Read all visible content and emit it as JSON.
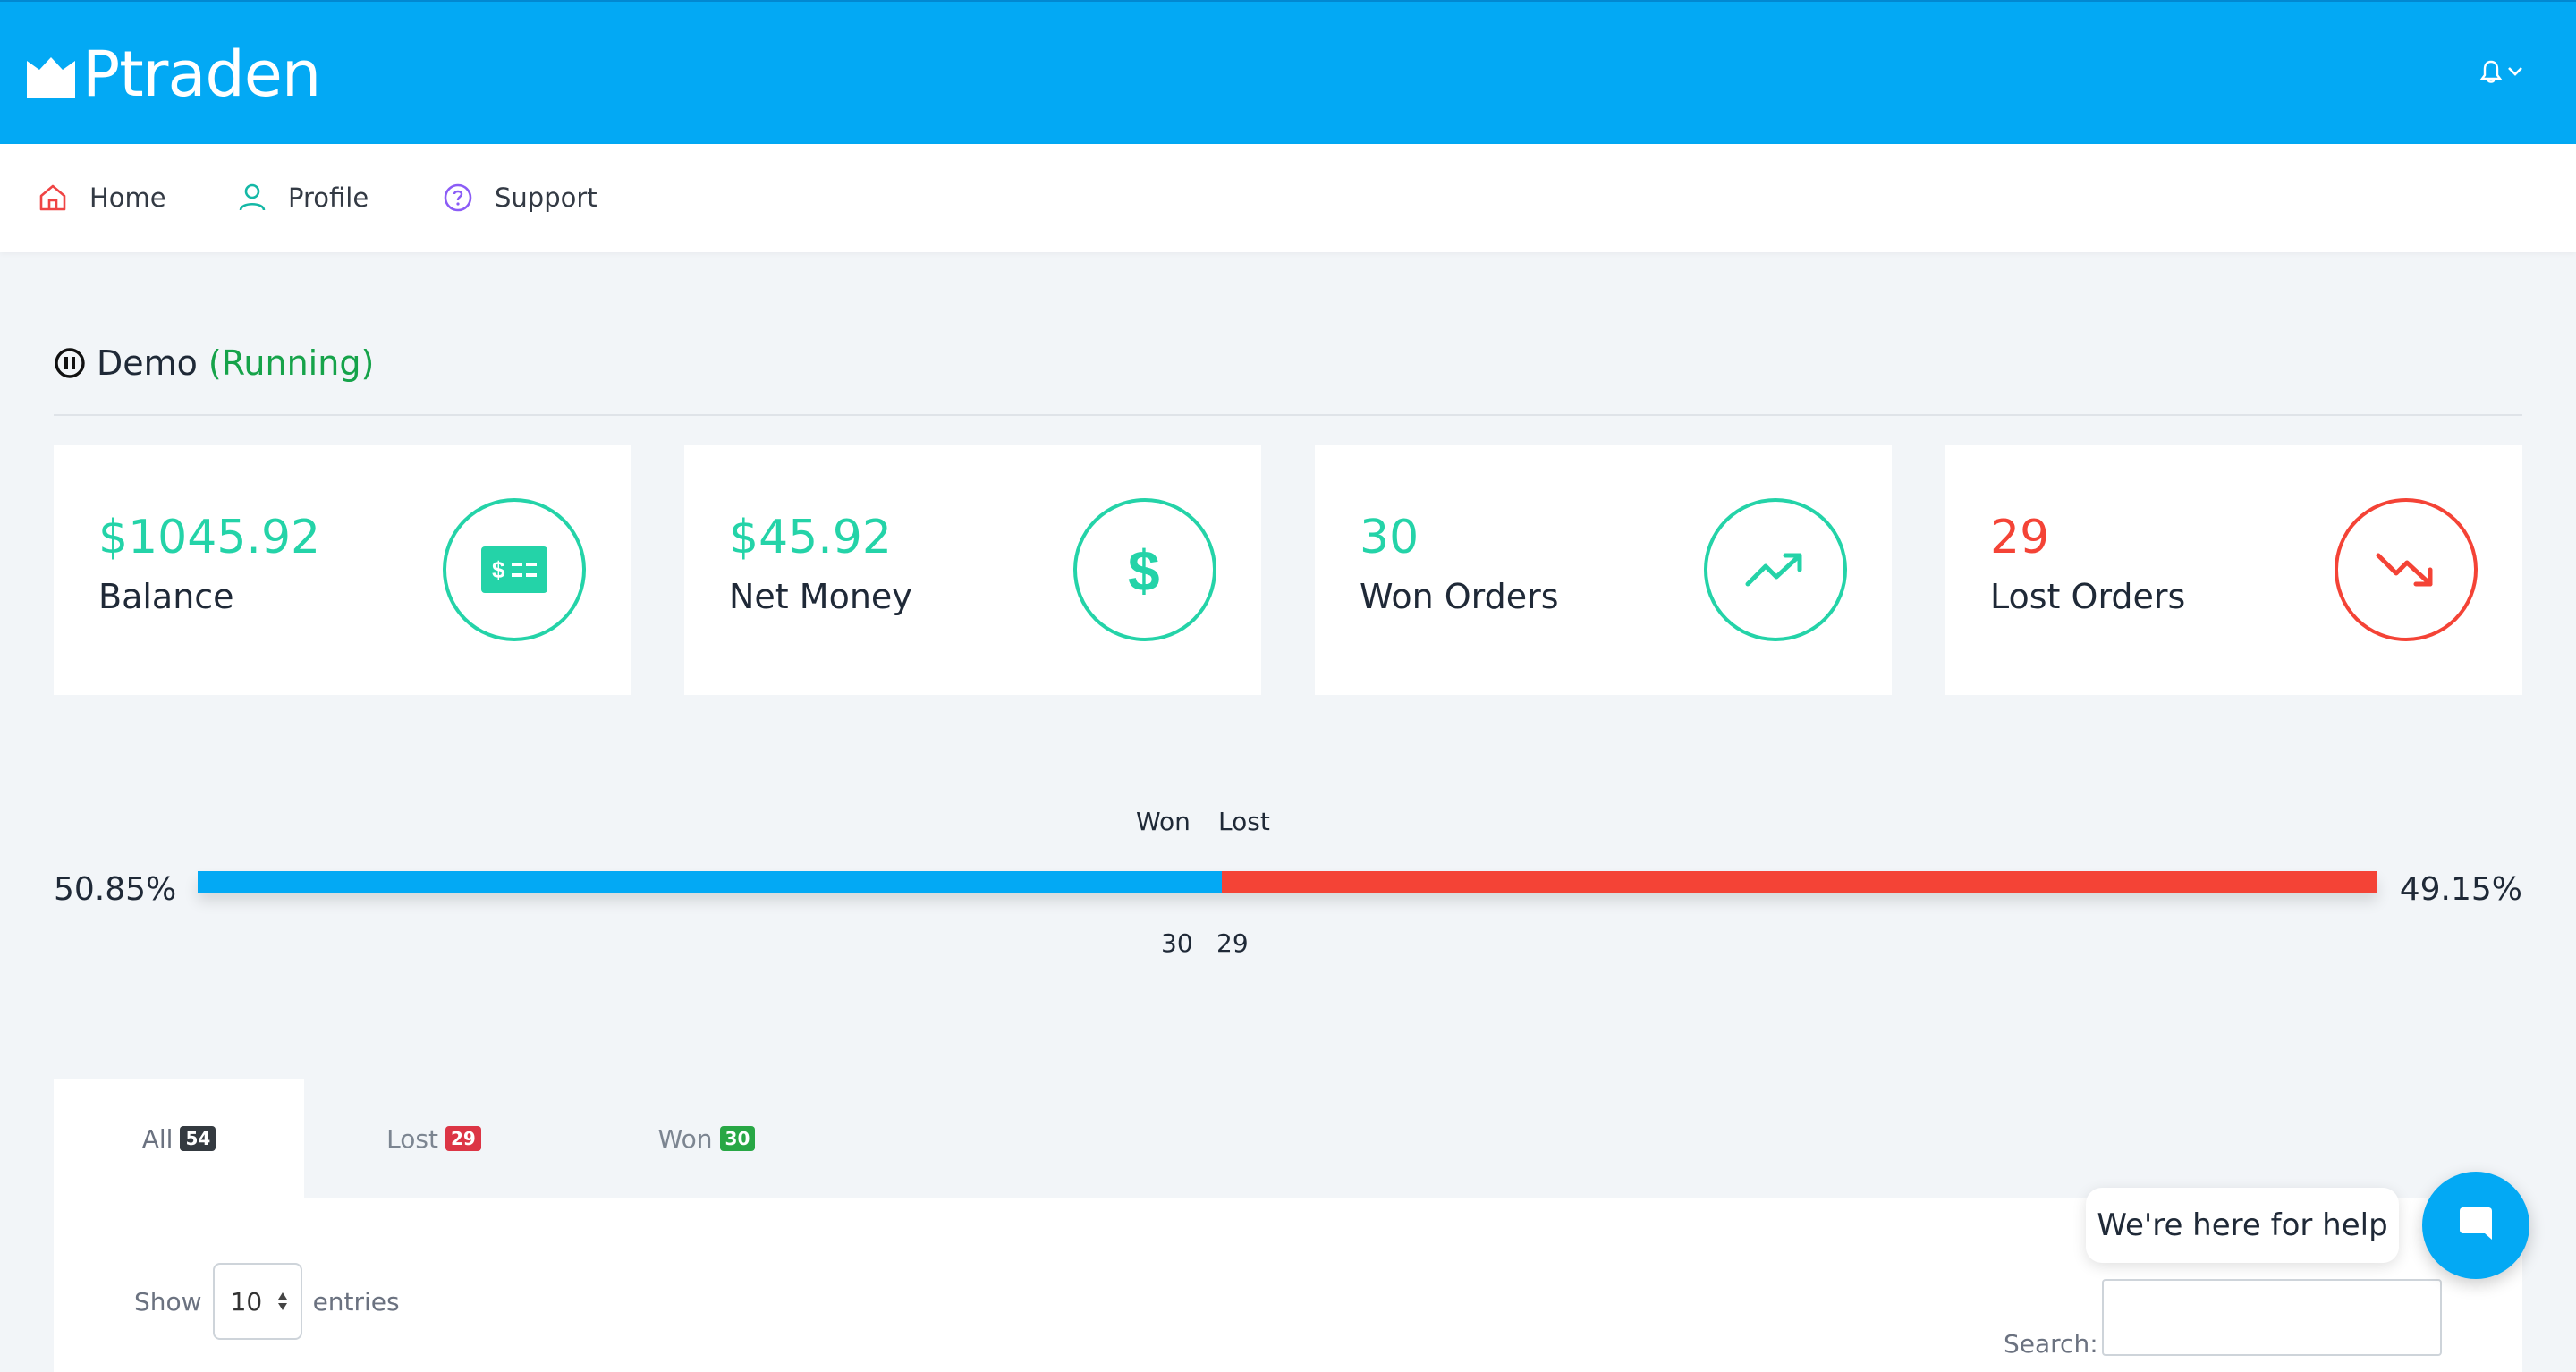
{
  "app": {
    "brand": "Ptraden"
  },
  "nav": {
    "home": "Home",
    "profile": "Profile",
    "support": "Support"
  },
  "bot": {
    "name": "Demo",
    "status": "(Running)"
  },
  "cards": {
    "balance": {
      "value": "$1045.92",
      "label": "Balance"
    },
    "net": {
      "value": "$45.92",
      "label": "Net Money"
    },
    "won": {
      "value": "30",
      "label": "Won Orders"
    },
    "lost": {
      "value": "29",
      "label": "Lost Orders"
    }
  },
  "ratio": {
    "won_pct_text": "50.85%",
    "lost_pct_text": "49.15%",
    "won_title": "Won",
    "lost_title": "Lost",
    "won_count": "30",
    "lost_count": "29",
    "won_fraction": 0.4698,
    "lost_fraction": 0.5302
  },
  "tabs": {
    "all": {
      "label": "All",
      "count": "54"
    },
    "lost": {
      "label": "Lost",
      "count": "29"
    },
    "won": {
      "label": "Won",
      "count": "30"
    }
  },
  "table": {
    "show_label": "Show",
    "page_size": "10",
    "entries_label": "entries",
    "search_label": "Search:",
    "search_value": ""
  },
  "chat": {
    "help_text": "We're here for help"
  },
  "colors": {
    "primary": "#03a9f4",
    "success": "#24d3a8",
    "danger": "#f44336",
    "running": "#16a34a"
  }
}
